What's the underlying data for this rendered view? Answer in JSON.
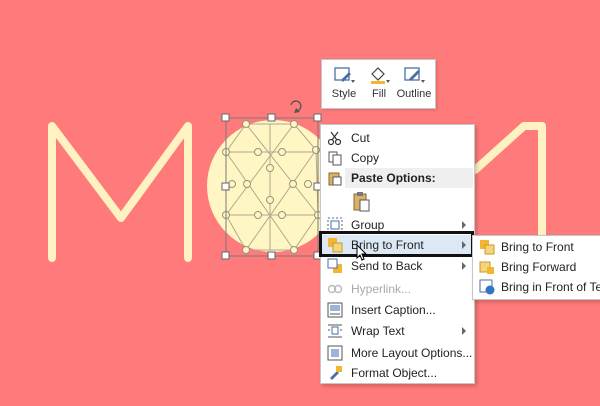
{
  "colors": {
    "background": "#ff7b7b",
    "letters": "#fff2c2",
    "shape_fill": "#fff6c4",
    "highlight": "#dde8f5"
  },
  "mini_toolbar": {
    "style_label": "Style",
    "fill_label": "Fill",
    "outline_label": "Outline"
  },
  "menu": {
    "cut": "Cut",
    "copy": "Copy",
    "paste_options": "Paste Options:",
    "group": "Group",
    "bring_to_front": "Bring to Front",
    "send_to_back": "Send to Back",
    "hyperlink": "Hyperlink...",
    "insert_caption": "Insert Caption...",
    "wrap_text": "Wrap Text",
    "more_layout": "More Layout Options...",
    "format_object": "Format Object..."
  },
  "submenu": {
    "bring_to_front": "Bring to Front",
    "bring_forward": "Bring Forward",
    "bring_in_front_of_text": "Bring in Front of Text"
  }
}
